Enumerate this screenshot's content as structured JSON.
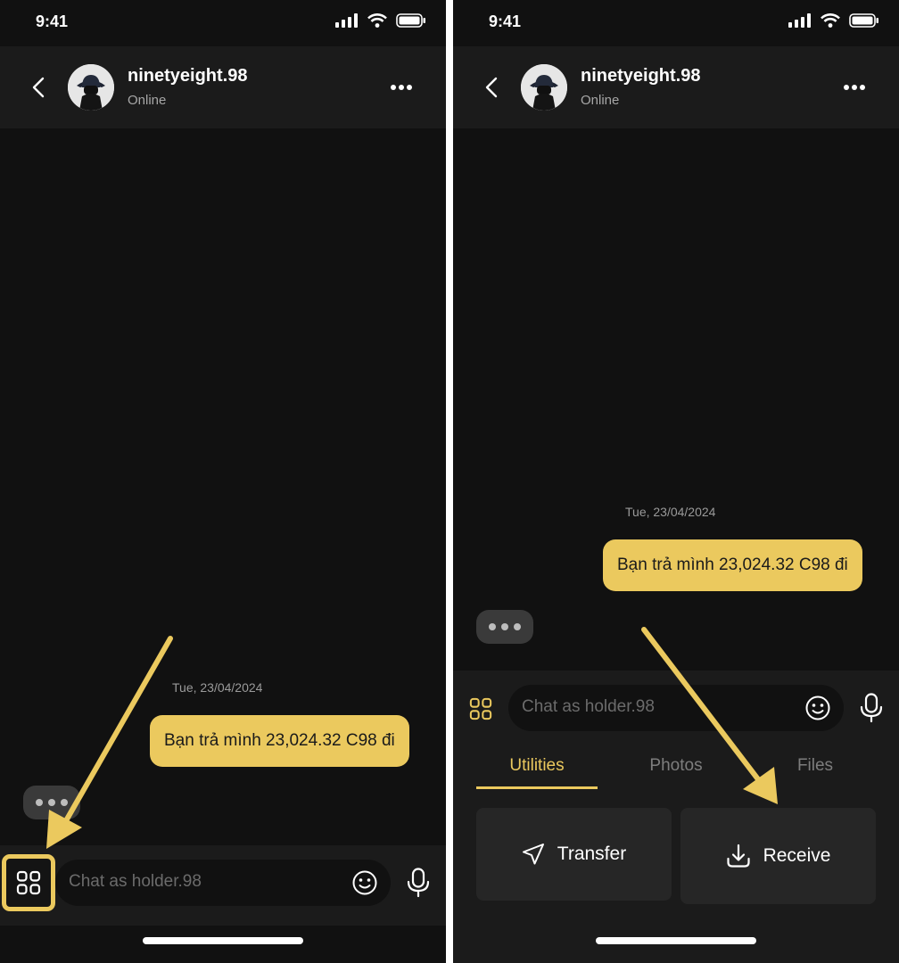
{
  "status": {
    "time": "9:41"
  },
  "contact": {
    "name": "ninetyeight.98",
    "status": "Online"
  },
  "conversation": {
    "date": "Tue, 23/04/2024",
    "message": "Bạn trả mình 23,024.32 C98 đi"
  },
  "composer": {
    "placeholder": "Chat as holder.98"
  },
  "tabs": [
    {
      "label": "Utilities",
      "active": true
    },
    {
      "label": "Photos",
      "active": false
    },
    {
      "label": "Files",
      "active": false
    }
  ],
  "actions": {
    "transfer": "Transfer",
    "receive": "Receive"
  },
  "colors": {
    "accent": "#ebc95e",
    "background": "#111111",
    "panel": "#1b1b1b",
    "card": "#262626"
  },
  "icons": [
    "back-chevron-icon",
    "more-dots-icon",
    "grid-apps-icon",
    "emoji-icon",
    "microphone-icon",
    "send-arrow-icon",
    "download-icon",
    "signal-icon",
    "wifi-icon",
    "battery-icon"
  ]
}
